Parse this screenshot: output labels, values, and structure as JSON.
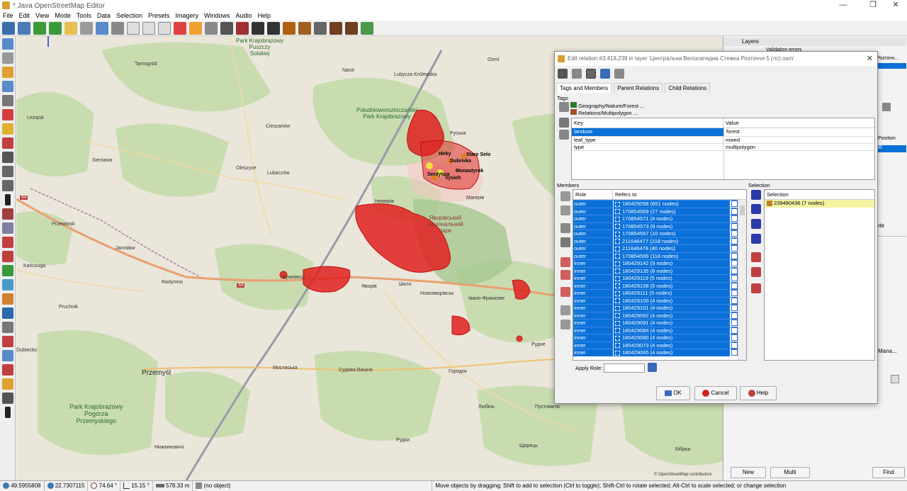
{
  "window": {
    "title": "* Java OpenStreetMap Editor",
    "minimize": "—",
    "maximize": "❐",
    "close": "✕"
  },
  "menu": [
    "File",
    "Edit",
    "View",
    "Mode",
    "Tools",
    "Data",
    "Selection",
    "Presets",
    "Imagery",
    "Windows",
    "Audio",
    "Help"
  ],
  "map": {
    "labels": {
      "park1": "Park Krajobrazowy\nPuszczy\nSolskiej",
      "park2": "Południoworoztoczański\nPark Krajobrazowy",
      "park3": "Park Krajobrazowy\nPogórza\nPrzemyskiego",
      "park4": "Яворівський\nнаціональний\nпарк",
      "tarnogrod": "Tarnogród",
      "narol": "Narol",
      "lubycza": "Lubycza Królewska",
      "osmi": "Osmi",
      "lezajsk": "Leżajsk",
      "cieszanow": "Cieszanów",
      "sieniawa": "Sieniawa",
      "oleszyce": "Oleszyce",
      "lubaczow": "Lubaczów",
      "przeworsk": "Przeworsk",
      "jaroslaw": "Jarosław",
      "kanczuga": "Kańczuga",
      "radymno": "Radymno",
      "pruchnik": "Pruchnik",
      "dubiecko": "Dubiecko",
      "przemysl": "Przemyśl",
      "mosciska": "Мостиська",
      "sudova": "Судова Вишня",
      "horodok": "Городок",
      "novoyavorivsk": "Новояворівськ",
      "shklo": "Шкло",
      "yavoriv": "Яворів",
      "ivano": "Івано-Франкове",
      "nyzhankovychi": "Нижанковичі",
      "rudky": "Рудки",
      "lyubin": "Любінь",
      "pustomyty": "Пустомити",
      "shchyrets": "Щирець",
      "bibrka": "Бібрка",
      "rusky": "Рудне",
      "magerov": "Магерів",
      "ruska": "Руська",
      "hirky": "Hirky",
      "stare_selo": "Stare Selo",
      "dubrivka": "Dubrivka",
      "monastyrok": "Monastyrok",
      "serdytsia": "Serdytsia",
      "vysich": "Vysich",
      "kraklivets": "Краківець",
      "nemyriv": "Немирів",
      "a4a": "A4",
      "a4b": "A4",
      "attribution": "© OpenStreetMap contributors"
    }
  },
  "right_panel": {
    "layers_title": "Layers",
    "validation_errors": "Validation errors",
    "layer_item": "Розточч...",
    "position_label": "Position",
    "position_value": "56",
    "delete_label": "ete",
    "manage_label": "Mana...",
    "new_button": "New",
    "multi_button": "Multi",
    "find_button": "Find"
  },
  "dialog": {
    "title": "Edit relation #3,418,239 in layer 'Центральна Велосипедна Стежка Розточчя 5 (лс).osm'",
    "tabs": [
      "Tags and Members",
      "Parent Relations",
      "Child Relations"
    ],
    "tags_label": "Tags",
    "presets": [
      "Geography/Nature/Forest ...",
      "Relations/Multipolygon ..."
    ],
    "tag_headers": {
      "key": "Key",
      "value": "Value"
    },
    "tags": [
      {
        "key": "landuse",
        "value": "forest"
      },
      {
        "key": "leaf_type",
        "value": "mixed"
      },
      {
        "key": "type",
        "value": "multipolygon"
      }
    ],
    "members_label": "Members",
    "member_headers": {
      "role": "Role",
      "refers_to": "Refers to"
    },
    "members": [
      {
        "role": "outer",
        "ref": "180429058 (651 nodes)"
      },
      {
        "role": "outer",
        "ref": "170854569 (27 nodes)"
      },
      {
        "role": "outer",
        "ref": "170854571 (4 nodes)"
      },
      {
        "role": "outer",
        "ref": "170854573 (9 nodes)"
      },
      {
        "role": "outer",
        "ref": "170854567 (10 nodes)"
      },
      {
        "role": "outer",
        "ref": "211646477 (218 nodes)"
      },
      {
        "role": "outer",
        "ref": "211646478 (40 nodes)"
      },
      {
        "role": "outer",
        "ref": "170854599 (118 nodes)"
      },
      {
        "role": "inner",
        "ref": "180429142 (9 nodes)"
      },
      {
        "role": "inner",
        "ref": "180429135 (8 nodes)"
      },
      {
        "role": "inner",
        "ref": "180429119 (5 nodes)"
      },
      {
        "role": "inner",
        "ref": "180429108 (5 nodes)"
      },
      {
        "role": "inner",
        "ref": "180429111 (5 nodes)"
      },
      {
        "role": "inner",
        "ref": "180429100 (4 nodes)"
      },
      {
        "role": "inner",
        "ref": "180429101 (4 nodes)"
      },
      {
        "role": "inner",
        "ref": "180429092 (4 nodes)"
      },
      {
        "role": "inner",
        "ref": "180429091 (4 nodes)"
      },
      {
        "role": "inner",
        "ref": "180429084 (4 nodes)"
      },
      {
        "role": "inner",
        "ref": "180429080 (4 nodes)"
      },
      {
        "role": "inner",
        "ref": "180429073 (4 nodes)"
      },
      {
        "role": "inner",
        "ref": "180429065 (4 nodes)"
      }
    ],
    "apply_role_label": "Apply Role:",
    "apply_role_value": "",
    "selection_label": "Selection",
    "selection_header": "Selection",
    "selection_items": [
      "239480436 (7 nodes)"
    ],
    "ok": "OK",
    "cancel": "Cancel",
    "help": "Help"
  },
  "status": {
    "lat": "49.5955808",
    "lon": "22.7307115",
    "angle": "74.64 °",
    "heading": "15.15 °",
    "distance": "578.33 m",
    "object": "(no object)",
    "hint": "Move objects by dragging; Shift to add to selection (Ctrl to toggle); Shift-Ctrl to rotate selected; Alt-Ctrl to scale selected; or change selection"
  },
  "colors": {
    "selection_blue": "#0a70d8",
    "forest_green": "#c8dcb0",
    "multipolygon_red": "#e02020",
    "road_orange": "#e8a070",
    "border_purple": "#b080b0",
    "selection_yellow": "#f4f4a0"
  }
}
